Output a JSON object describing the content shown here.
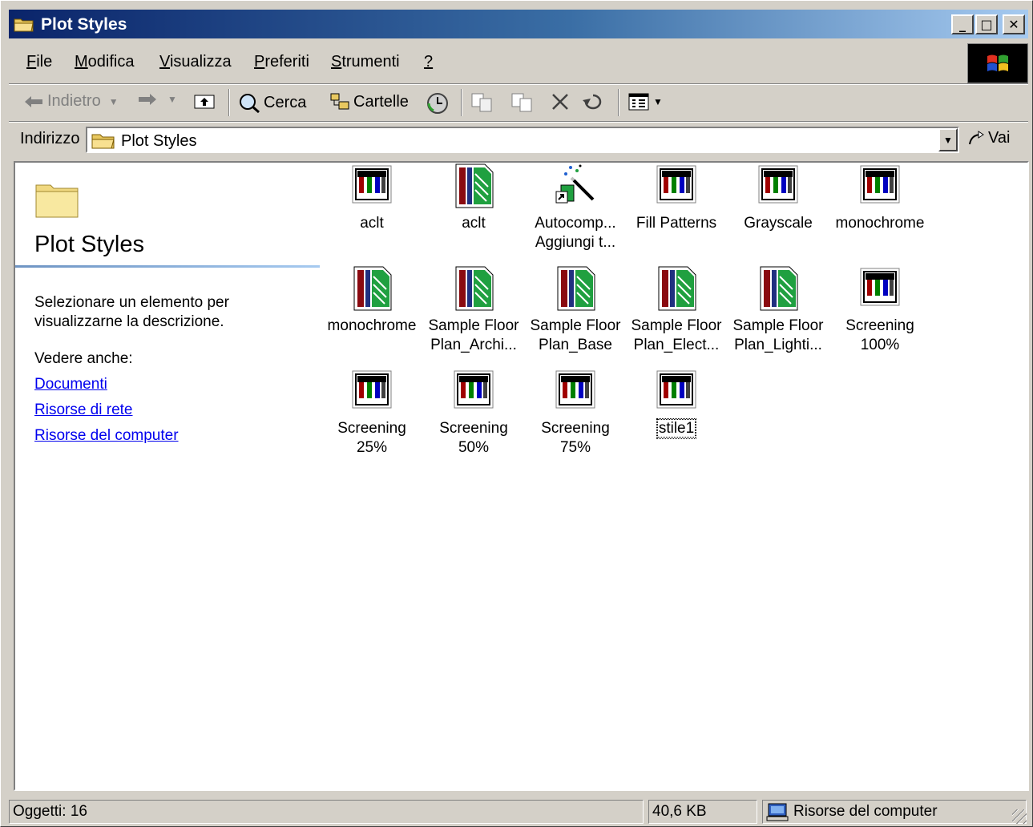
{
  "window": {
    "title": "Plot Styles",
    "controls": {
      "minimize": "_",
      "maximize": "□",
      "close": "✕"
    }
  },
  "menu": {
    "items": [
      {
        "key": "F",
        "rest": "ile"
      },
      {
        "key": "M",
        "rest": "odifica"
      },
      {
        "key": "V",
        "rest": "isualizza"
      },
      {
        "key": "P",
        "rest": "referiti"
      },
      {
        "key": "S",
        "rest": "trumenti"
      },
      {
        "key": "?",
        "rest": ""
      }
    ]
  },
  "toolbar": {
    "back": "Indietro",
    "search": "Cerca",
    "folders": "Cartelle"
  },
  "address": {
    "label": "Indirizzo",
    "value": "Plot Styles",
    "go": "Vai"
  },
  "left_pane": {
    "title": "Plot Styles",
    "description": "Selezionare un elemento per visualizzarne la descrizione.",
    "see_also": "Vedere anche:",
    "links": [
      "Documenti",
      "Risorse di rete",
      "Risorse del computer"
    ]
  },
  "files": [
    {
      "label": "aclt",
      "icon": "ctb-icon"
    },
    {
      "label": "aclt",
      "icon": "stb-icon"
    },
    {
      "label": "Autocomp...\nAggiungi t...",
      "icon": "wizard-shortcut-icon"
    },
    {
      "label": "Fill Patterns",
      "icon": "ctb-icon"
    },
    {
      "label": "Grayscale",
      "icon": "ctb-icon"
    },
    {
      "label": "monochrome",
      "icon": "ctb-icon"
    },
    {
      "label": "monochrome",
      "icon": "stb-icon"
    },
    {
      "label": "Sample Floor\nPlan_Archi...",
      "icon": "stb-icon"
    },
    {
      "label": "Sample Floor\nPlan_Base",
      "icon": "stb-icon"
    },
    {
      "label": "Sample Floor\nPlan_Elect...",
      "icon": "stb-icon"
    },
    {
      "label": "Sample Floor\nPlan_Lighti...",
      "icon": "stb-icon"
    },
    {
      "label": "Screening\n100%",
      "icon": "ctb-icon"
    },
    {
      "label": "Screening\n25%",
      "icon": "ctb-icon"
    },
    {
      "label": "Screening\n50%",
      "icon": "ctb-icon"
    },
    {
      "label": "Screening\n75%",
      "icon": "ctb-icon"
    },
    {
      "label": "stile1",
      "icon": "ctb-icon",
      "focused": true
    }
  ],
  "status": {
    "objects": "Oggetti: 16",
    "size": "40,6 KB",
    "zone": "Risorse del computer"
  },
  "colors": {
    "title_start": "#0a246a",
    "title_end": "#a6caf0",
    "link": "#0000ee",
    "face": "#d4d0c8"
  }
}
